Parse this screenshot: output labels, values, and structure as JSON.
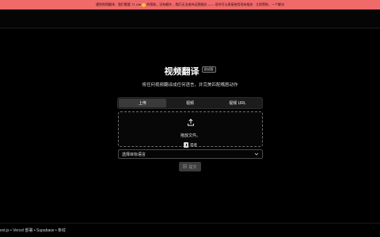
{
  "banner": {
    "text_before": "遇到视频翻译，我们需要 T1 Lite",
    "text_after": "的帮助，没有额外，我们无法维持运营服务 —— 但你可以直接使用现有服务 · 立即赞助，一个解决"
  },
  "hero": {
    "title": "视频翻译",
    "badge": "测试版",
    "subtitle": "将任何视频翻译成任何语言，并完美匹配嘴唇动作"
  },
  "tabs": [
    {
      "label": "上传",
      "active": true
    },
    {
      "label": "视频",
      "active": false
    },
    {
      "label": "视频 URL",
      "active": false
    }
  ],
  "dropzone": {
    "drop_text": "拖放文件。",
    "select_label": "或者"
  },
  "language_select": {
    "placeholder": "选择目标语言"
  },
  "submit": {
    "label": "提交"
  },
  "footer": {
    "text": "ext.js • Vercel 部署 • Supabase • 条纹"
  },
  "colors": {
    "banner_bg": "#f06a6a",
    "page_bg": "#000000",
    "tab_active": "#3a3a3a",
    "submit_bg": "#3c3c3c"
  },
  "icons": {
    "upload": "upload-icon",
    "file": "file-icon",
    "chevron": "chevron-down-icon",
    "submit": "play-icon",
    "emoji": "smile-emoji-icon"
  }
}
